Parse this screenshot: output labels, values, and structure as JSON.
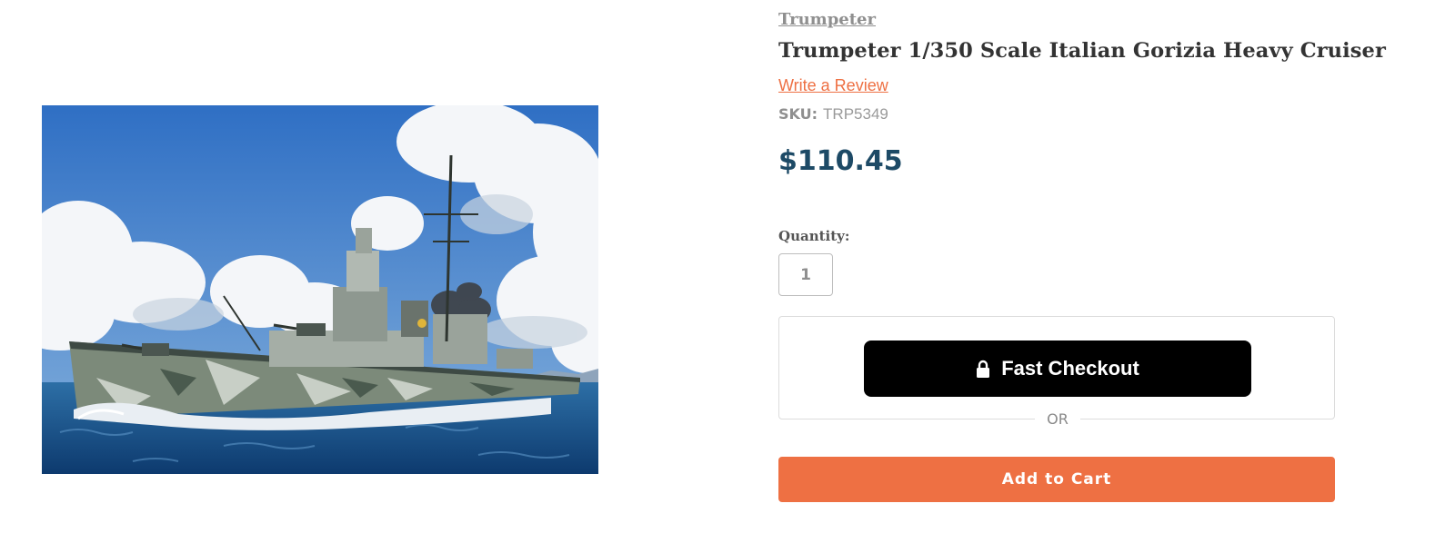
{
  "product": {
    "brand": "Trumpeter",
    "title": "Trumpeter 1/350 Scale Italian Gorizia Heavy Cruiser",
    "review_link": "Write a Review",
    "sku_label": "SKU:",
    "sku": "TRP5349",
    "price": "$110.45",
    "image_subject": "Gorizia heavy cruiser at sea"
  },
  "purchase": {
    "quantity_label": "Quantity:",
    "quantity_value": "1",
    "fast_checkout_label": "Fast Checkout",
    "fast_checkout_icon": "lock-icon",
    "or_label": "OR",
    "add_to_cart_label": "Add to Cart"
  },
  "colors": {
    "accent": "#ee7043",
    "price": "#1d4a66",
    "checkout_button": "#000000"
  }
}
